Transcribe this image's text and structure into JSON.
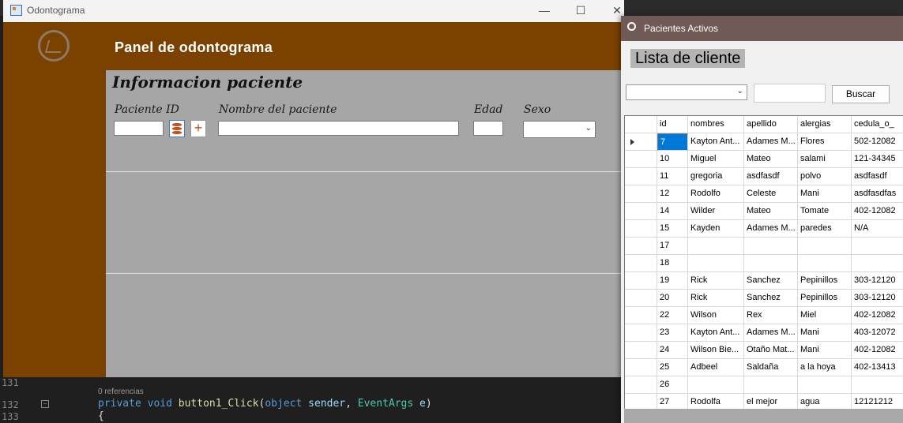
{
  "editor": {
    "line_top": "131",
    "refs": "0 referencias",
    "line_mid": "132",
    "line_bottom": "133",
    "code_kw1": "private",
    "code_kw2": "void",
    "code_fn": "button1_Click",
    "code_p1": "(",
    "code_kw3": "object",
    "code_p2": "sender",
    "code_p3": ", ",
    "code_ty": "EventArgs",
    "code_p4": "e",
    "code_p5": ")",
    "code_brace": "{"
  },
  "main_window": {
    "title": "Odontograma",
    "controls": {
      "minimize": "—",
      "maximize": "☐",
      "close": "✕"
    },
    "header_title": "Panel de odontograma",
    "section_title": "Informacion paciente",
    "labels": {
      "patient_id": "Paciente ID",
      "patient_name": "Nombre del paciente",
      "age": "Edad",
      "sex": "Sexo"
    },
    "plus_symbol": "+"
  },
  "list_window": {
    "title": "Pacientes Activos",
    "heading": "Lista de cliente",
    "search_button": "Buscar",
    "columns": [
      "id",
      "nombres",
      "apellido",
      "alergias",
      "cedula_o_"
    ],
    "rows": [
      [
        "7",
        "Kayton Ant...",
        "Adames M...",
        "Flores",
        "502-12082"
      ],
      [
        "10",
        "Miguel",
        "Mateo",
        "salami",
        "121-34345"
      ],
      [
        "11",
        "gregoria",
        "asdfasdf",
        "polvo",
        "asdfasdf"
      ],
      [
        "12",
        "Rodolfo",
        "Celeste",
        "Mani",
        "asdfasdfas"
      ],
      [
        "14",
        "Wilder",
        "Mateo",
        "Tomate",
        "402-12082"
      ],
      [
        "15",
        "Kayden",
        "Adames M...",
        "paredes",
        "N/A"
      ],
      [
        "17",
        "",
        "",
        "",
        ""
      ],
      [
        "18",
        "",
        "",
        "",
        ""
      ],
      [
        "19",
        "Rick",
        "Sanchez",
        "Pepinillos",
        "303-12120"
      ],
      [
        "20",
        "Rick",
        "Sanchez",
        "Pepinillos",
        "303-12120"
      ],
      [
        "22",
        "Wilson",
        "Rex",
        "Miel",
        "402-12082"
      ],
      [
        "23",
        "Kayton Ant...",
        "Adames M...",
        "Mani",
        "403-12072"
      ],
      [
        "24",
        "Wilson Bie...",
        "Otaño Mat...",
        "Mani",
        "402-12082"
      ],
      [
        "25",
        "Adbeel",
        "Saldaña",
        "a la hoya",
        "402-13413"
      ],
      [
        "26",
        "",
        "",
        "",
        ""
      ],
      [
        "27",
        "Rodolfa",
        "el mejor",
        "agua",
        "12121212"
      ]
    ],
    "selected_row": 0
  },
  "colors": {
    "brand_brown": "#7a4100",
    "panel_gray": "#a6a6a6",
    "selection_blue": "#0078d7",
    "list_titlebar": "#705a55"
  }
}
